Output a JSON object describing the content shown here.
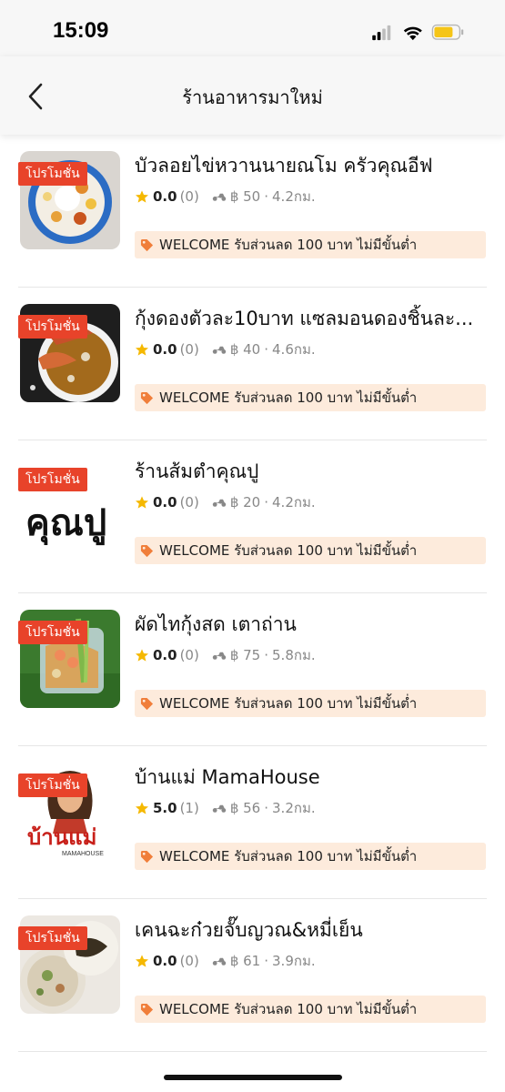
{
  "status_bar": {
    "time": "15:09"
  },
  "header": {
    "title": "ร้านอาหารมาใหม่"
  },
  "colors": {
    "promo": "#e8432a",
    "coupon_bg": "#fdebdc",
    "star": "#f5b800",
    "tag_icon": "#f07e3a"
  },
  "restaurants": [
    {
      "promo": "โปรโมชั่น",
      "name": "บัวลอยไข่หวานนายณโม ครัวคุณอีฟ",
      "rating": "0.0",
      "count": "(0)",
      "fee": "฿ 50",
      "distance": "4.2กม.",
      "coupon": "WELCOME รับส่วนลด 100 บาท ไม่มีขั้นต่ำ"
    },
    {
      "promo": "โปรโมชั่น",
      "name": "กุ้งดองตัวละ10บาท แซลมอนดองชิ้นละ...",
      "rating": "0.0",
      "count": "(0)",
      "fee": "฿ 40",
      "distance": "4.6กม.",
      "coupon": "WELCOME รับส่วนลด 100 บาท ไม่มีขั้นต่ำ"
    },
    {
      "promo": "โปรโมชั่น",
      "name": "ร้านส้มตำคุณปู",
      "rating": "0.0",
      "count": "(0)",
      "fee": "฿ 20",
      "distance": "4.2กม.",
      "coupon": "WELCOME รับส่วนลด 100 บาท ไม่มีขั้นต่ำ",
      "logo_text": "คุณปู"
    },
    {
      "promo": "โปรโมชั่น",
      "name": "ผัดไทกุ้งสด เตาถ่าน",
      "rating": "0.0",
      "count": "(0)",
      "fee": "฿ 75",
      "distance": "5.8กม.",
      "coupon": "WELCOME รับส่วนลด 100 บาท ไม่มีขั้นต่ำ"
    },
    {
      "promo": "โปรโมชั่น",
      "name": "บ้านแม่ MamaHouse",
      "rating": "5.0",
      "count": "(1)",
      "fee": "฿ 56",
      "distance": "3.2กม.",
      "coupon": "WELCOME รับส่วนลด 100 บาท ไม่มีขั้นต่ำ",
      "logo_text": "บ้านแม่"
    },
    {
      "promo": "โปรโมชั่น",
      "name": "เคนฉะก๋วยจั๊บญวณ&หมี่เย็น",
      "rating": "0.0",
      "count": "(0)",
      "fee": "฿ 61",
      "distance": "3.9กม.",
      "coupon": "WELCOME รับส่วนลด 100 บาท ไม่มีขั้นต่ำ"
    }
  ]
}
